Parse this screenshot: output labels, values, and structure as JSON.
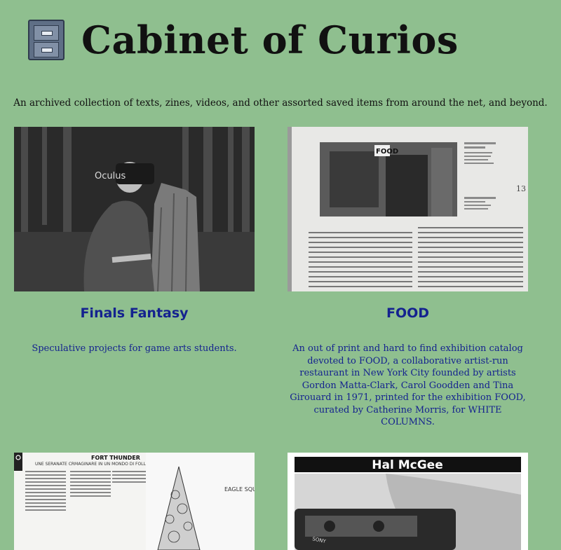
{
  "header": {
    "title": "Cabinet of Curios",
    "icon": "file-cabinet-icon",
    "subtitle": "An archived collection of texts, zines, videos, and other assorted saved items from around the net, and beyond."
  },
  "items": [
    {
      "title": "Finals Fantasy",
      "description": "Speculative projects for game arts students.",
      "image_text": "Oculus"
    },
    {
      "title": "FOOD",
      "description": "An out of print and hard to find exhibition catalog devoted to FOOD, a collaborative artist-run restaurant in New York City founded by artists Gordon Matta-Clark, Carol Goodden and Tina Girouard in 1971, printed for the exhibition FOOD, curated by Catherine Morris, for WHITE COLUMNS.",
      "image_text": "FOOD",
      "page_number": "13"
    },
    {
      "title": "",
      "description": "",
      "image_text": "FORT THUNDER",
      "image_subtext": "UNE SERANATE CRMAGINARE IN UN MONDO DI FOLLIA",
      "image_label": "EAGLE SQUARE"
    },
    {
      "title": "",
      "description": "",
      "image_text": "Hal McGee",
      "image_subtext": "SONY"
    }
  ],
  "colors": {
    "background": "#8fbf8f",
    "link": "#14228f",
    "text": "#111111"
  }
}
